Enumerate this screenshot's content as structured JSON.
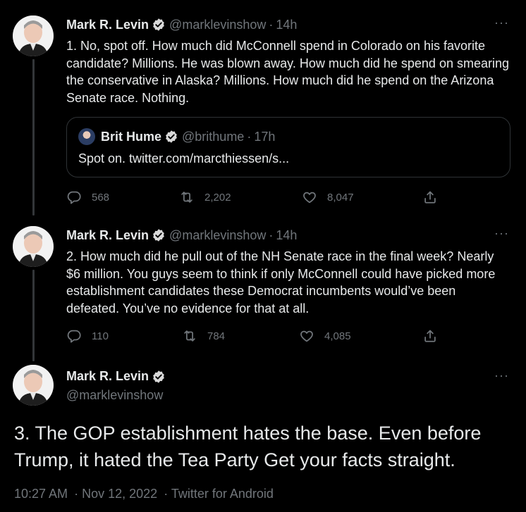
{
  "tweets": [
    {
      "name": "Mark R. Levin",
      "handle": "@marklevinshow",
      "time": "14h",
      "text": "1. No, spot off.  How much did McConnell spend in Colorado on his favorite candidate? Millions.  He was blown away. How much did he spend on smearing the conservative in Alaska? Millions.  How much did he spend on the Arizona Senate race.  Nothing.",
      "quote": {
        "name": "Brit Hume",
        "handle": "@brithume",
        "time": "17h",
        "text": "Spot on. twitter.com/marcthiessen/s..."
      },
      "replies": "568",
      "retweets": "2,202",
      "likes": "8,047"
    },
    {
      "name": "Mark R. Levin",
      "handle": "@marklevinshow",
      "time": "14h",
      "text": "2. How much did he pull out of the NH Senate race in the final week? Nearly $6 million. You guys seem to think if only McConnell could have picked more establishment candidates these Democrat incumbents would’ve been defeated. You’ve no evidence for that at all.",
      "replies": "110",
      "retweets": "784",
      "likes": "4,085"
    }
  ],
  "main": {
    "name": "Mark R. Levin",
    "handle": "@marklevinshow",
    "text": "3. The GOP establishment hates the base. Even before Trump, it hated the Tea Party  Get your facts straight.",
    "time": "10:27 AM",
    "date": "Nov 12, 2022",
    "source": "Twitter for Android"
  },
  "separators": {
    "dot": "·",
    "more": "···"
  },
  "colors": {
    "background": "#000000",
    "text": "#e7e9ea",
    "muted": "#71767b",
    "verified": "#d9d9d9",
    "border": "#2f3336"
  },
  "icons": [
    "verified-badge-icon",
    "reply-icon",
    "retweet-icon",
    "like-icon",
    "share-icon",
    "more-icon"
  ]
}
